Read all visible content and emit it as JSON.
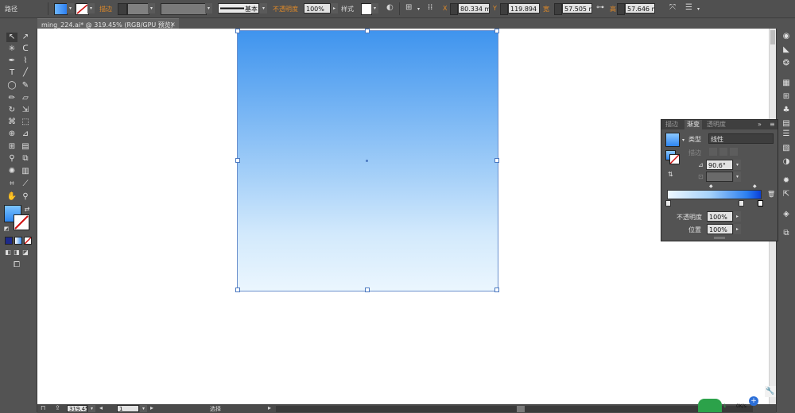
{
  "control_bar": {
    "object_type": "路径",
    "stroke_label": "描边",
    "stroke_profile": "基本",
    "opacity_label": "不透明度",
    "opacity_value": "100%",
    "style_label": "样式",
    "x_label": "X",
    "x_value": "80.334 mm",
    "y_label": "Y",
    "y_value": "119.894 mm",
    "w_label": "宽",
    "w_value": "57.505 mm",
    "h_label": "高",
    "h_value": "57.646 mm"
  },
  "document_tab": {
    "title": "ming_224.ai* @ 319.45% (RGB/GPU 预览)",
    "close": "×"
  },
  "gradient_panel": {
    "tabs": [
      "描边",
      "渐变",
      "透明度"
    ],
    "active_tab": "渐变",
    "type_label": "类型",
    "type_value": "线性",
    "stroke_label": "描边",
    "angle_value": "90.6°",
    "opacity_label": "不透明度",
    "opacity_value": "100%",
    "location_label": "位置",
    "location_value": "100%",
    "menu_icon": "panel-menu-icon"
  },
  "status_bar": {
    "zoom_value": "319.45",
    "artboard_value": "1",
    "tool_name": "选择"
  },
  "network_widget": {
    "speed": "0K/s"
  },
  "colors": {
    "gradient_top": "#3f94ee",
    "gradient_bottom": "#ebf6fe",
    "selection": "#4a78c0",
    "accent_orange": "#e08a28"
  }
}
